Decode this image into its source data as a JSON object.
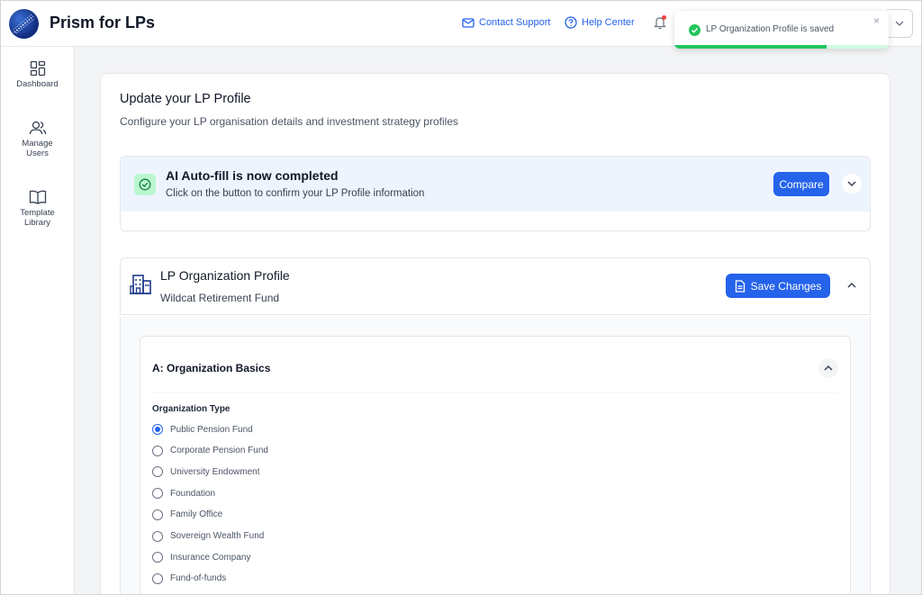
{
  "app": {
    "title": "Prism for LPs",
    "logo_icon": "globe-logo-icon"
  },
  "header": {
    "contact_support": "Contact Support",
    "help_center": "Help Center",
    "notification_icon": "bell-icon"
  },
  "toast": {
    "message": "LP Organization Profile is saved",
    "close": "×",
    "progress": 0.71,
    "accent": "#22c55e"
  },
  "sidebar": {
    "items": [
      {
        "label": "Dashboard",
        "icon": "dashboard-icon"
      },
      {
        "label": "Manage Users",
        "icon": "users-icon"
      },
      {
        "label": "Template Library",
        "icon": "book-icon"
      }
    ]
  },
  "page": {
    "title": "Update your LP Profile",
    "subtitle": "Configure your LP organisation details and investment strategy profiles"
  },
  "ai_banner": {
    "title": "AI Auto-fill is now completed",
    "subtitle": "Click on the button to confirm your LP Profile information",
    "compare_label": "Compare"
  },
  "org_profile": {
    "title": "LP Organization Profile",
    "fund_name": "Wildcat Retirement Fund",
    "save_label": "Save Changes"
  },
  "section_a": {
    "title": "A: Organization Basics",
    "field_label": "Organization Type",
    "options": [
      {
        "label": "Public Pension Fund",
        "checked": true
      },
      {
        "label": "Corporate Pension Fund",
        "checked": false
      },
      {
        "label": "University Endowment",
        "checked": false
      },
      {
        "label": "Foundation",
        "checked": false
      },
      {
        "label": "Family Office",
        "checked": false
      },
      {
        "label": "Sovereign Wealth Fund",
        "checked": false
      },
      {
        "label": "Insurance Company",
        "checked": false
      },
      {
        "label": "Fund-of-funds",
        "checked": false
      }
    ]
  },
  "colors": {
    "primary": "#2563eb",
    "success": "#22c55e",
    "banner_bg": "#eef4fe"
  }
}
